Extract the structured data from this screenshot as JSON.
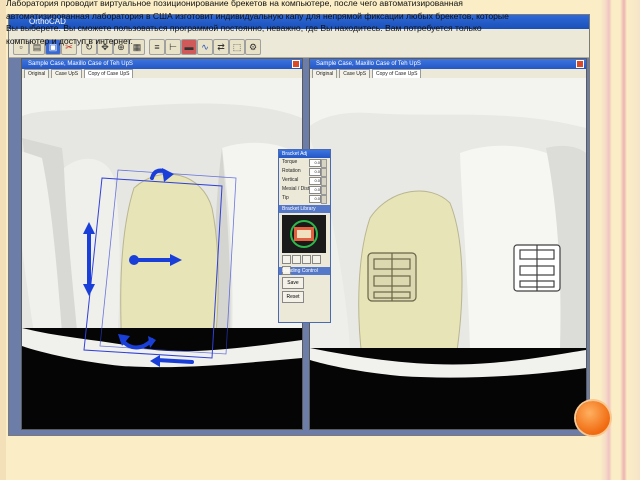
{
  "overlay": {
    "line1": "Лаборатория проводит виртуальное позиционирование брекетов на компьютере, после чего автоматизированная",
    "line2": "автоматизированная лаборатория в США изготовит индивидуальную капу для непрямой фиксации любых брекетов, которые",
    "line3": "Вы выберете. Вы сможете пользоваться программой постоянно, неважно, где Вы находитесь. Вам потребуется только",
    "line4": "компьютер и доступ в интернет."
  },
  "app": {
    "title": "OrthoCAD"
  },
  "viewports": [
    {
      "title": "Sample Case, Maxillo Case of Teh UpS",
      "tabs": [
        "Original",
        "Case UpS",
        "Copy of Case UpS"
      ]
    },
    {
      "title": "Sample Case, Maxillo Case of Teh UpS",
      "tabs": [
        "Original",
        "Case UpS",
        "Copy of Case UpS"
      ]
    }
  ],
  "tool_panel": {
    "title": "Bracket Adj",
    "rows": [
      {
        "label": "Torque",
        "value": "0.0"
      },
      {
        "label": "Rotation",
        "value": "0.0"
      },
      {
        "label": "Vertical",
        "value": "0.0"
      },
      {
        "label": "Mesial / Distal",
        "value": "0.0"
      },
      {
        "label": "Tip",
        "value": "0.0"
      }
    ],
    "section": "Bracket Library",
    "footer": "Bonding Control",
    "buttons": [
      "Save",
      "Reset"
    ]
  },
  "colors": {
    "arrow": "#1a3fd8",
    "tooth": "#e7e4b8",
    "accent": "#f06a10"
  }
}
